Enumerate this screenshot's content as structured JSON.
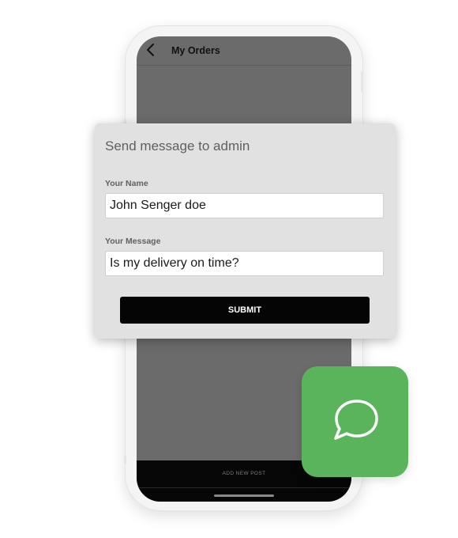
{
  "header": {
    "title": "My Orders"
  },
  "bottom_bar": {
    "label": "ADD NEW POST"
  },
  "dialog": {
    "title": "Send message to admin",
    "name_label": "Your Name",
    "name_value": "John Senger doe",
    "message_label": "Your Message",
    "message_value": "Is my delivery on time?",
    "submit_label": "SUBMIT"
  },
  "icons": {
    "back": "chevron-left-icon",
    "chat": "chat-bubble-icon"
  },
  "colors": {
    "screen_overlay": "#6b6b6b",
    "dialog_bg": "#e1e1e1",
    "button_bg": "#050505",
    "accent_green": "#59b45c"
  }
}
